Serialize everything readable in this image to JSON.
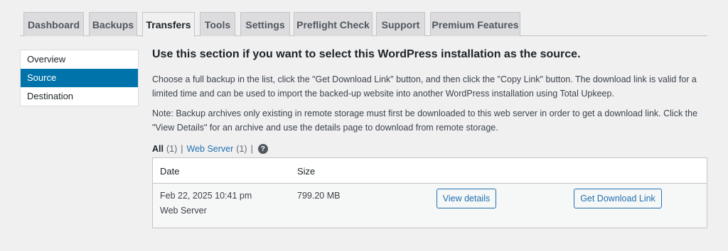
{
  "tabs": [
    {
      "label": "Dashboard"
    },
    {
      "label": "Backups"
    },
    {
      "label": "Transfers"
    },
    {
      "label": "Tools"
    },
    {
      "label": "Settings"
    },
    {
      "label": "Preflight Check"
    },
    {
      "label": "Support"
    },
    {
      "label": "Premium Features"
    }
  ],
  "active_tab": "Transfers",
  "sidenav": {
    "items": [
      {
        "label": "Overview"
      },
      {
        "label": "Source"
      },
      {
        "label": "Destination"
      }
    ],
    "active": "Source"
  },
  "main": {
    "heading": "Use this section if you want to select this WordPress installation as the source.",
    "paragraph1": "Choose a full backup in the list, click the \"Get Download Link\" button, and then click the \"Copy Link\" button. The download link is valid for a limited time and can be used to import the backed-up website into another WordPress installation using Total Upkeep.",
    "paragraph2": "Note: Backup archives only existing in remote storage must first be downloaded to this web server in order to get a download link. Click the \"View Details\" for an archive and use the details page to download from remote storage."
  },
  "filters": {
    "all_label": "All",
    "all_count": "(1)",
    "separator": "|",
    "web_server_label": "Web Server",
    "web_server_count": "(1)",
    "help_glyph": "?"
  },
  "table": {
    "columns": [
      "Date",
      "Size"
    ],
    "rows": [
      {
        "date": "Feb 22, 2025 10:41 pm",
        "location": "Web Server",
        "size": "799.20 MB",
        "view_details_label": "View details",
        "download_label": "Get Download Link"
      }
    ]
  },
  "colors": {
    "accent": "#0073aa",
    "link": "#2271b1",
    "background": "#f0f0f1"
  }
}
